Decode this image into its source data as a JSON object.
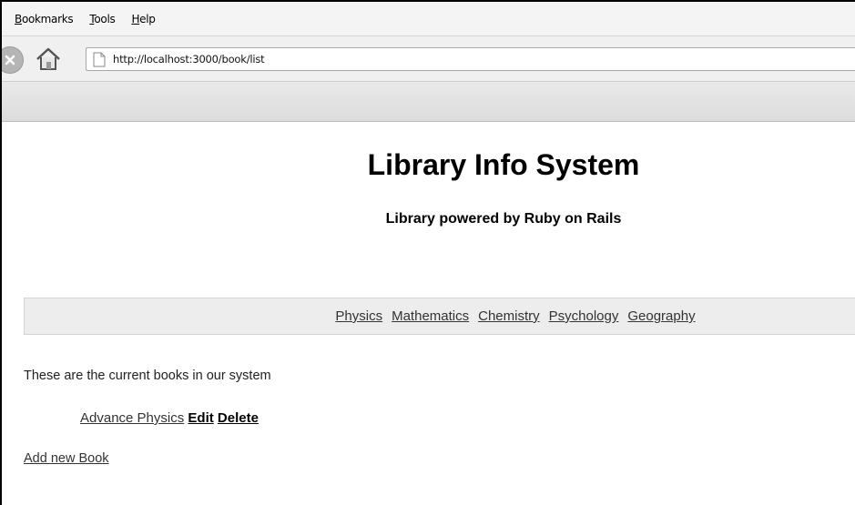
{
  "menu": {
    "items": [
      {
        "label": "Bookmarks"
      },
      {
        "label": "Tools"
      },
      {
        "label": "Help"
      }
    ]
  },
  "address": {
    "url": "http://localhost:3000/book/list"
  },
  "page": {
    "title": "Library Info System",
    "subtitle": "Library powered by Ruby on Rails",
    "categories": [
      "Physics",
      "Mathematics",
      "Chemistry",
      "Psychology",
      "Geography"
    ],
    "intro_text": "These are the current books in our system",
    "books": [
      {
        "title": "Advance Physics",
        "edit_label": "Edit",
        "delete_label": "Delete"
      }
    ],
    "add_book_label": "Add new Book"
  },
  "colors": {
    "chrome": "#f0f0f0",
    "category_bar": "#ededed",
    "link": "#333333"
  }
}
